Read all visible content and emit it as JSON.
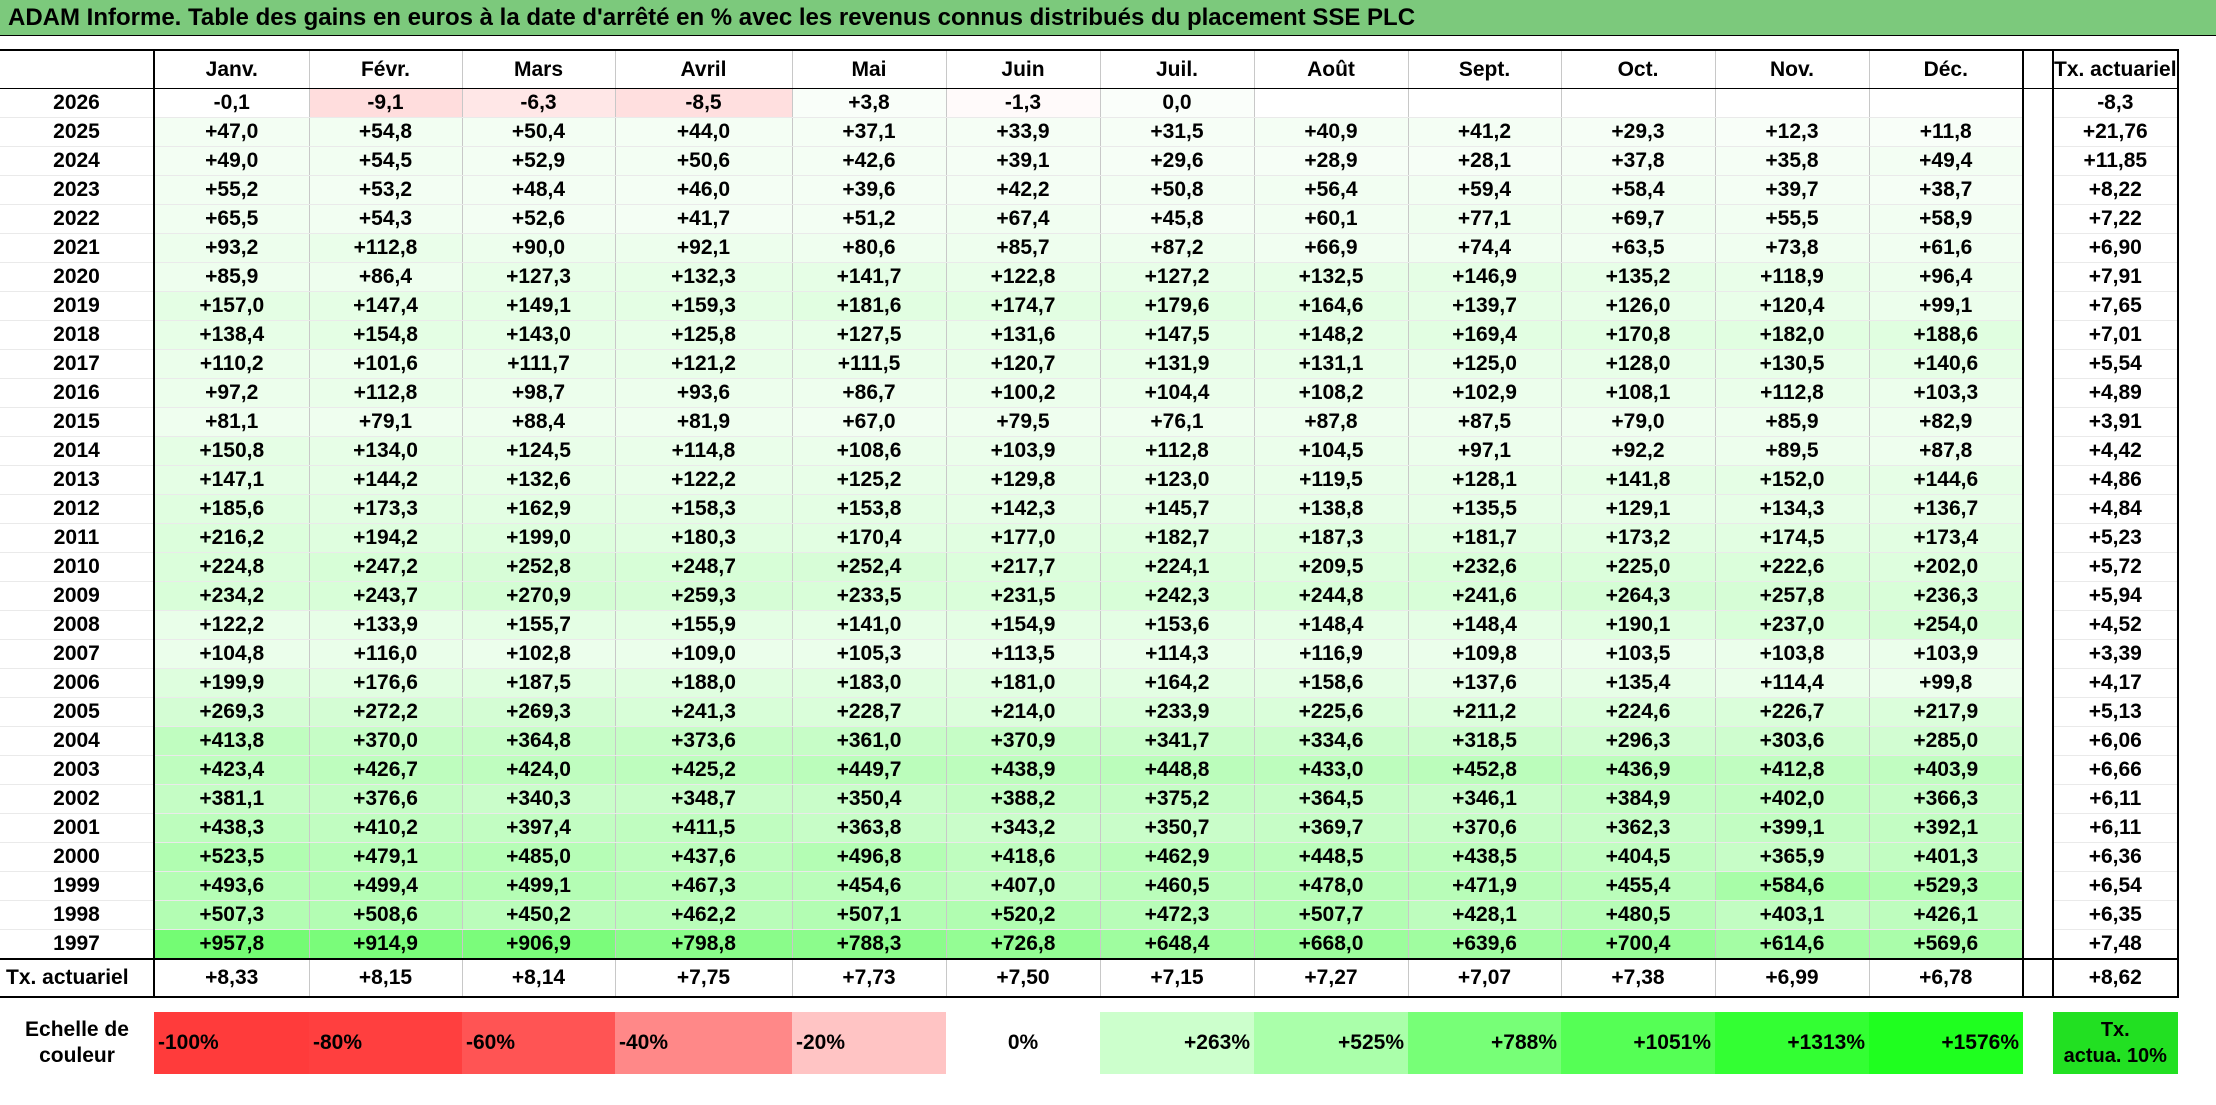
{
  "title": "ADAM Informe. Table des gains en euros à la date d'arrêté en % avec les revenus connus distribués du placement SSE PLC",
  "colors": {
    "title_bg": "#7cc97c",
    "max_green": "#5ef55e",
    "neg_red": "#ff3333",
    "white": "#ffffff"
  },
  "chart_data": {
    "type": "heatmap",
    "title": "ADAM Informe. Table des gains en euros à la date d'arrêté en % avec les revenus connus distribués du placement SSE PLC",
    "months": [
      "Janv.",
      "Févr.",
      "Mars",
      "Avril",
      "Mai",
      "Juin",
      "Juil.",
      "Août",
      "Sept.",
      "Oct.",
      "Nov.",
      "Déc."
    ],
    "rate_header": "Tx. actuariel",
    "rows": [
      {
        "year": "2026",
        "values": [
          "-0,1",
          "-9,1",
          "-6,3",
          "-8,5",
          "+3,8",
          "-1,3",
          "0,0",
          "",
          "",
          "",
          "",
          ""
        ],
        "rate": "-8,3"
      },
      {
        "year": "2025",
        "values": [
          "+47,0",
          "+54,8",
          "+50,4",
          "+44,0",
          "+37,1",
          "+33,9",
          "+31,5",
          "+40,9",
          "+41,2",
          "+29,3",
          "+12,3",
          "+11,8"
        ],
        "rate": "+21,76"
      },
      {
        "year": "2024",
        "values": [
          "+49,0",
          "+54,5",
          "+52,9",
          "+50,6",
          "+42,6",
          "+39,1",
          "+29,6",
          "+28,9",
          "+28,1",
          "+37,8",
          "+35,8",
          "+49,4"
        ],
        "rate": "+11,85"
      },
      {
        "year": "2023",
        "values": [
          "+55,2",
          "+53,2",
          "+48,4",
          "+46,0",
          "+39,6",
          "+42,2",
          "+50,8",
          "+56,4",
          "+59,4",
          "+58,4",
          "+39,7",
          "+38,7"
        ],
        "rate": "+8,22"
      },
      {
        "year": "2022",
        "values": [
          "+65,5",
          "+54,3",
          "+52,6",
          "+41,7",
          "+51,2",
          "+67,4",
          "+45,8",
          "+60,1",
          "+77,1",
          "+69,7",
          "+55,5",
          "+58,9"
        ],
        "rate": "+7,22"
      },
      {
        "year": "2021",
        "values": [
          "+93,2",
          "+112,8",
          "+90,0",
          "+92,1",
          "+80,6",
          "+85,7",
          "+87,2",
          "+66,9",
          "+74,4",
          "+63,5",
          "+73,8",
          "+61,6"
        ],
        "rate": "+6,90"
      },
      {
        "year": "2020",
        "values": [
          "+85,9",
          "+86,4",
          "+127,3",
          "+132,3",
          "+141,7",
          "+122,8",
          "+127,2",
          "+132,5",
          "+146,9",
          "+135,2",
          "+118,9",
          "+96,4"
        ],
        "rate": "+7,91"
      },
      {
        "year": "2019",
        "values": [
          "+157,0",
          "+147,4",
          "+149,1",
          "+159,3",
          "+181,6",
          "+174,7",
          "+179,6",
          "+164,6",
          "+139,7",
          "+126,0",
          "+120,4",
          "+99,1"
        ],
        "rate": "+7,65"
      },
      {
        "year": "2018",
        "values": [
          "+138,4",
          "+154,8",
          "+143,0",
          "+125,8",
          "+127,5",
          "+131,6",
          "+147,5",
          "+148,2",
          "+169,4",
          "+170,8",
          "+182,0",
          "+188,6"
        ],
        "rate": "+7,01"
      },
      {
        "year": "2017",
        "values": [
          "+110,2",
          "+101,6",
          "+111,7",
          "+121,2",
          "+111,5",
          "+120,7",
          "+131,9",
          "+131,1",
          "+125,0",
          "+128,0",
          "+130,5",
          "+140,6"
        ],
        "rate": "+5,54"
      },
      {
        "year": "2016",
        "values": [
          "+97,2",
          "+112,8",
          "+98,7",
          "+93,6",
          "+86,7",
          "+100,2",
          "+104,4",
          "+108,2",
          "+102,9",
          "+108,1",
          "+112,8",
          "+103,3"
        ],
        "rate": "+4,89"
      },
      {
        "year": "2015",
        "values": [
          "+81,1",
          "+79,1",
          "+88,4",
          "+81,9",
          "+67,0",
          "+79,5",
          "+76,1",
          "+87,8",
          "+87,5",
          "+79,0",
          "+85,9",
          "+82,9"
        ],
        "rate": "+3,91"
      },
      {
        "year": "2014",
        "values": [
          "+150,8",
          "+134,0",
          "+124,5",
          "+114,8",
          "+108,6",
          "+103,9",
          "+112,8",
          "+104,5",
          "+97,1",
          "+92,2",
          "+89,5",
          "+87,8"
        ],
        "rate": "+4,42"
      },
      {
        "year": "2013",
        "values": [
          "+147,1",
          "+144,2",
          "+132,6",
          "+122,2",
          "+125,2",
          "+129,8",
          "+123,0",
          "+119,5",
          "+128,1",
          "+141,8",
          "+152,0",
          "+144,6"
        ],
        "rate": "+4,86"
      },
      {
        "year": "2012",
        "values": [
          "+185,6",
          "+173,3",
          "+162,9",
          "+158,3",
          "+153,8",
          "+142,3",
          "+145,7",
          "+138,8",
          "+135,5",
          "+129,1",
          "+134,3",
          "+136,7"
        ],
        "rate": "+4,84"
      },
      {
        "year": "2011",
        "values": [
          "+216,2",
          "+194,2",
          "+199,0",
          "+180,3",
          "+170,4",
          "+177,0",
          "+182,7",
          "+187,3",
          "+181,7",
          "+173,2",
          "+174,5",
          "+173,4"
        ],
        "rate": "+5,23"
      },
      {
        "year": "2010",
        "values": [
          "+224,8",
          "+247,2",
          "+252,8",
          "+248,7",
          "+252,4",
          "+217,7",
          "+224,1",
          "+209,5",
          "+232,6",
          "+225,0",
          "+222,6",
          "+202,0"
        ],
        "rate": "+5,72"
      },
      {
        "year": "2009",
        "values": [
          "+234,2",
          "+243,7",
          "+270,9",
          "+259,3",
          "+233,5",
          "+231,5",
          "+242,3",
          "+244,8",
          "+241,6",
          "+264,3",
          "+257,8",
          "+236,3"
        ],
        "rate": "+5,94"
      },
      {
        "year": "2008",
        "values": [
          "+122,2",
          "+133,9",
          "+155,7",
          "+155,9",
          "+141,0",
          "+154,9",
          "+153,6",
          "+148,4",
          "+148,4",
          "+190,1",
          "+237,0",
          "+254,0"
        ],
        "rate": "+4,52"
      },
      {
        "year": "2007",
        "values": [
          "+104,8",
          "+116,0",
          "+102,8",
          "+109,0",
          "+105,3",
          "+113,5",
          "+114,3",
          "+116,9",
          "+109,8",
          "+103,5",
          "+103,8",
          "+103,9"
        ],
        "rate": "+3,39"
      },
      {
        "year": "2006",
        "values": [
          "+199,9",
          "+176,6",
          "+187,5",
          "+188,0",
          "+183,0",
          "+181,0",
          "+164,2",
          "+158,6",
          "+137,6",
          "+135,4",
          "+114,4",
          "+99,8"
        ],
        "rate": "+4,17"
      },
      {
        "year": "2005",
        "values": [
          "+269,3",
          "+272,2",
          "+269,3",
          "+241,3",
          "+228,7",
          "+214,0",
          "+233,9",
          "+225,6",
          "+211,2",
          "+224,6",
          "+226,7",
          "+217,9"
        ],
        "rate": "+5,13"
      },
      {
        "year": "2004",
        "values": [
          "+413,8",
          "+370,0",
          "+364,8",
          "+373,6",
          "+361,0",
          "+370,9",
          "+341,7",
          "+334,6",
          "+318,5",
          "+296,3",
          "+303,6",
          "+285,0"
        ],
        "rate": "+6,06"
      },
      {
        "year": "2003",
        "values": [
          "+423,4",
          "+426,7",
          "+424,0",
          "+425,2",
          "+449,7",
          "+438,9",
          "+448,8",
          "+433,0",
          "+452,8",
          "+436,9",
          "+412,8",
          "+403,9"
        ],
        "rate": "+6,66"
      },
      {
        "year": "2002",
        "values": [
          "+381,1",
          "+376,6",
          "+340,3",
          "+348,7",
          "+350,4",
          "+388,2",
          "+375,2",
          "+364,5",
          "+346,1",
          "+384,9",
          "+402,0",
          "+366,3"
        ],
        "rate": "+6,11"
      },
      {
        "year": "2001",
        "values": [
          "+438,3",
          "+410,2",
          "+397,4",
          "+411,5",
          "+363,8",
          "+343,2",
          "+350,7",
          "+369,7",
          "+370,6",
          "+362,3",
          "+399,1",
          "+392,1"
        ],
        "rate": "+6,11"
      },
      {
        "year": "2000",
        "values": [
          "+523,5",
          "+479,1",
          "+485,0",
          "+437,6",
          "+496,8",
          "+418,6",
          "+462,9",
          "+448,5",
          "+438,5",
          "+404,5",
          "+365,9",
          "+401,3"
        ],
        "rate": "+6,36"
      },
      {
        "year": "1999",
        "values": [
          "+493,6",
          "+499,4",
          "+499,1",
          "+467,3",
          "+454,6",
          "+407,0",
          "+460,5",
          "+478,0",
          "+471,9",
          "+455,4",
          "+584,6",
          "+529,3"
        ],
        "rate": "+6,54"
      },
      {
        "year": "1998",
        "values": [
          "+507,3",
          "+508,6",
          "+450,2",
          "+462,2",
          "+507,1",
          "+520,2",
          "+472,3",
          "+507,7",
          "+428,1",
          "+480,5",
          "+403,1",
          "+426,1"
        ],
        "rate": "+6,35"
      },
      {
        "year": "1997",
        "values": [
          "+957,8",
          "+914,9",
          "+906,9",
          "+798,8",
          "+788,3",
          "+726,8",
          "+648,4",
          "+668,0",
          "+639,6",
          "+700,4",
          "+614,6",
          "+569,6"
        ],
        "rate": "+7,48"
      }
    ],
    "footer": {
      "label": "Tx. actuariel",
      "values": [
        "+8,33",
        "+8,15",
        "+8,14",
        "+7,75",
        "+7,73",
        "+7,50",
        "+7,15",
        "+7,27",
        "+7,07",
        "+7,38",
        "+6,99",
        "+6,78"
      ],
      "rate": "+8,62"
    },
    "legend": {
      "label_line1": "Echelle de",
      "label_line2": "couleur",
      "stops": [
        {
          "label": "-100%",
          "color": "#ff3b3b"
        },
        {
          "label": "-80%",
          "color": "#ff3f3f"
        },
        {
          "label": "-60%",
          "color": "#ff5454"
        },
        {
          "label": "-40%",
          "color": "#ff8888"
        },
        {
          "label": "-20%",
          "color": "#ffc4c4"
        },
        {
          "label": "0%",
          "color": "#ffffff"
        },
        {
          "label": "+263%",
          "color": "#ccffcc"
        },
        {
          "label": "+525%",
          "color": "#aaffaa"
        },
        {
          "label": "+788%",
          "color": "#77ff77"
        },
        {
          "label": "+1051%",
          "color": "#55ff55"
        },
        {
          "label": "+1313%",
          "color": "#33ff33"
        },
        {
          "label": "+1576%",
          "color": "#1fff1f"
        }
      ],
      "rate_label_line1": "Tx.",
      "rate_label_line2": "actua. 10%",
      "rate_color": "#22e022"
    },
    "color_scale": {
      "min": -100,
      "max": 1576
    }
  }
}
